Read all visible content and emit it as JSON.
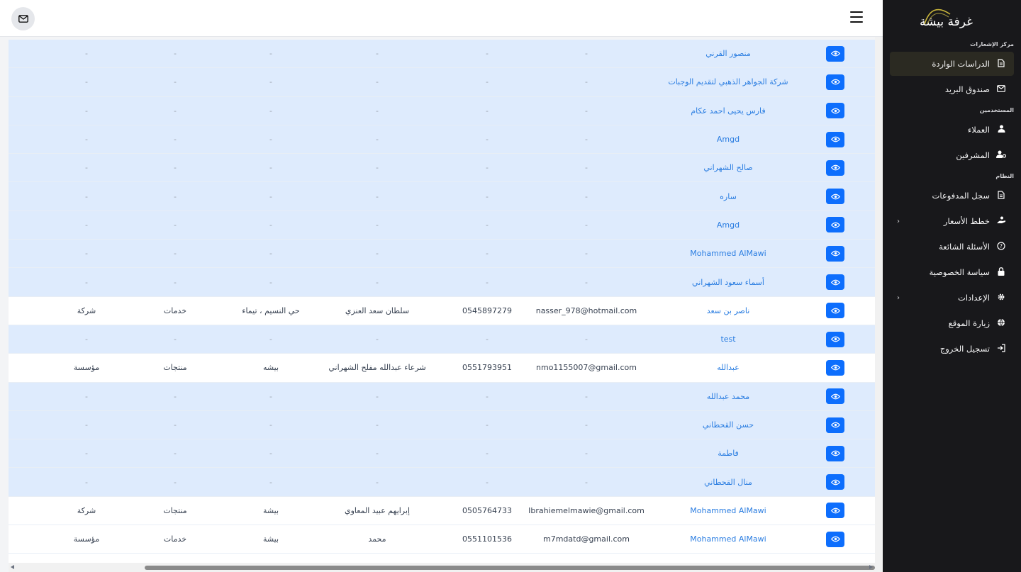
{
  "sidebar": {
    "brand": "غرفة بيشة",
    "sections": {
      "notifications": "مركز الإشعارات",
      "users": "المستخدمين",
      "system": "النظام"
    },
    "items": [
      {
        "label": "الدراسات الواردة",
        "icon": "document-icon"
      },
      {
        "label": "صندوق البريد",
        "icon": "mail-icon"
      },
      {
        "label": "العملاء",
        "icon": "user-icon"
      },
      {
        "label": "المشرفين",
        "icon": "user-cog-icon"
      },
      {
        "label": "سجل المدفوعات",
        "icon": "receipt-icon"
      },
      {
        "label": "خطط الأسعار",
        "icon": "hand-coins-icon"
      },
      {
        "label": "الأسئلة الشائعة",
        "icon": "question-circle-icon"
      },
      {
        "label": "سياسة الخصوصية",
        "icon": "lock-icon"
      },
      {
        "label": "الإعدادات",
        "icon": "gear-icon"
      },
      {
        "label": "زيارة الموقع",
        "icon": "globe-icon"
      },
      {
        "label": "تسجيل الخروج",
        "icon": "logout-icon"
      }
    ]
  },
  "table": {
    "rows": [
      {
        "name": "منصور القرني",
        "email": "-",
        "phone": "-",
        "person": "-",
        "address": "-",
        "category": "-",
        "type": "-"
      },
      {
        "name": "شركة الجواهر الذهبي لتقديم الوجبات",
        "email": "-",
        "phone": "-",
        "person": "-",
        "address": "-",
        "category": "-",
        "type": "-"
      },
      {
        "name": "فارس يحيى احمد عكام",
        "email": "-",
        "phone": "-",
        "person": "-",
        "address": "-",
        "category": "-",
        "type": "-"
      },
      {
        "name": "Amgd",
        "email": "-",
        "phone": "-",
        "person": "-",
        "address": "-",
        "category": "-",
        "type": "-"
      },
      {
        "name": "صالح الشهراني",
        "email": "-",
        "phone": "-",
        "person": "-",
        "address": "-",
        "category": "-",
        "type": "-"
      },
      {
        "name": "ساره",
        "email": "-",
        "phone": "-",
        "person": "-",
        "address": "-",
        "category": "-",
        "type": "-"
      },
      {
        "name": "Amgd",
        "email": "-",
        "phone": "-",
        "person": "-",
        "address": "-",
        "category": "-",
        "type": "-"
      },
      {
        "name": "Mohammed AlMawi",
        "email": "-",
        "phone": "-",
        "person": "-",
        "address": "-",
        "category": "-",
        "type": "-"
      },
      {
        "name": "أسماء سعود الشهراني",
        "email": "-",
        "phone": "-",
        "person": "-",
        "address": "-",
        "category": "-",
        "type": "-"
      },
      {
        "name": "ناصر بن سعد",
        "email": "nasser_978@hotmail.com",
        "phone": "0545897279",
        "person": "سلطان سعد العنزي",
        "address": "حي النسيم ، تيماء",
        "category": "خدمات",
        "type": "شركة"
      },
      {
        "name": "test",
        "email": "-",
        "phone": "-",
        "person": "-",
        "address": "-",
        "category": "-",
        "type": "-"
      },
      {
        "name": "عبدالله",
        "email": "nmo1155007@gmail.com",
        "phone": "0551793951",
        "person": "شرعاء عبدالله مفلح الشهراني",
        "address": "بيشه",
        "category": "منتجات",
        "type": "مؤسسة"
      },
      {
        "name": "محمد عبدالله",
        "email": "-",
        "phone": "-",
        "person": "-",
        "address": "-",
        "category": "-",
        "type": "-"
      },
      {
        "name": "حسن القحطاني",
        "email": "-",
        "phone": "-",
        "person": "-",
        "address": "-",
        "category": "-",
        "type": "-"
      },
      {
        "name": "فاطمة",
        "email": "-",
        "phone": "-",
        "person": "-",
        "address": "-",
        "category": "-",
        "type": "-"
      },
      {
        "name": "منال القحطاني",
        "email": "-",
        "phone": "-",
        "person": "-",
        "address": "-",
        "category": "-",
        "type": "-"
      },
      {
        "name": "Mohammed AlMawi",
        "email": "Ibrahiemelmawie@gmail.com",
        "phone": "0505764733",
        "person": "إبرايهم عبيد المعاوي",
        "address": "بيشة",
        "category": "منتجات",
        "type": "شركة"
      },
      {
        "name": "Mohammed AlMawi",
        "email": "m7mdatd@gmail.com",
        "phone": "0551101536",
        "person": "محمد",
        "address": "بيشة",
        "category": "خدمات",
        "type": "مؤسسة"
      }
    ]
  },
  "colors": {
    "sidebar_bg": "#18181b",
    "row_highlight": "#deebfd",
    "link": "#2a7de1",
    "primary_button": "#0d6efd"
  }
}
